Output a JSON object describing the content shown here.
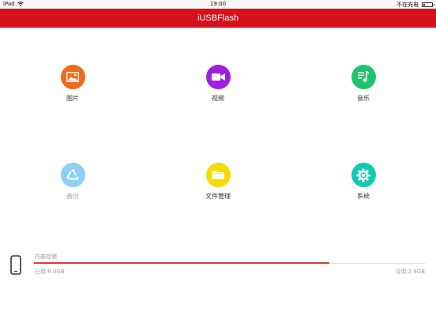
{
  "statusbar": {
    "device": "iPad",
    "time": "19:00",
    "charging": "不在充电",
    "battery_level": 0.15
  },
  "header": {
    "title": "iUSBFlash"
  },
  "tiles": [
    {
      "label": "图片",
      "icon": "image-icon",
      "color": "#f26a1b",
      "enabled": true
    },
    {
      "label": "视频",
      "icon": "video-camera-icon",
      "color": "#a01ee0",
      "enabled": true
    },
    {
      "label": "音乐",
      "icon": "music-note-icon",
      "color": "#1fc46a",
      "enabled": true
    },
    {
      "label": "备份",
      "icon": "recycle-icon",
      "color": "#8dd0f2",
      "enabled": false
    },
    {
      "label": "文件管理",
      "icon": "folder-icon",
      "color": "#f7dc00",
      "enabled": true
    },
    {
      "label": "系统",
      "icon": "gear-icon",
      "color": "#12c9b4",
      "enabled": true
    }
  ],
  "storage": {
    "title": "内部存储",
    "used": "已用:9.0GB",
    "free": "可用:2.9GB",
    "used_fraction": 0.756,
    "bar_color": "#e03a3a"
  }
}
